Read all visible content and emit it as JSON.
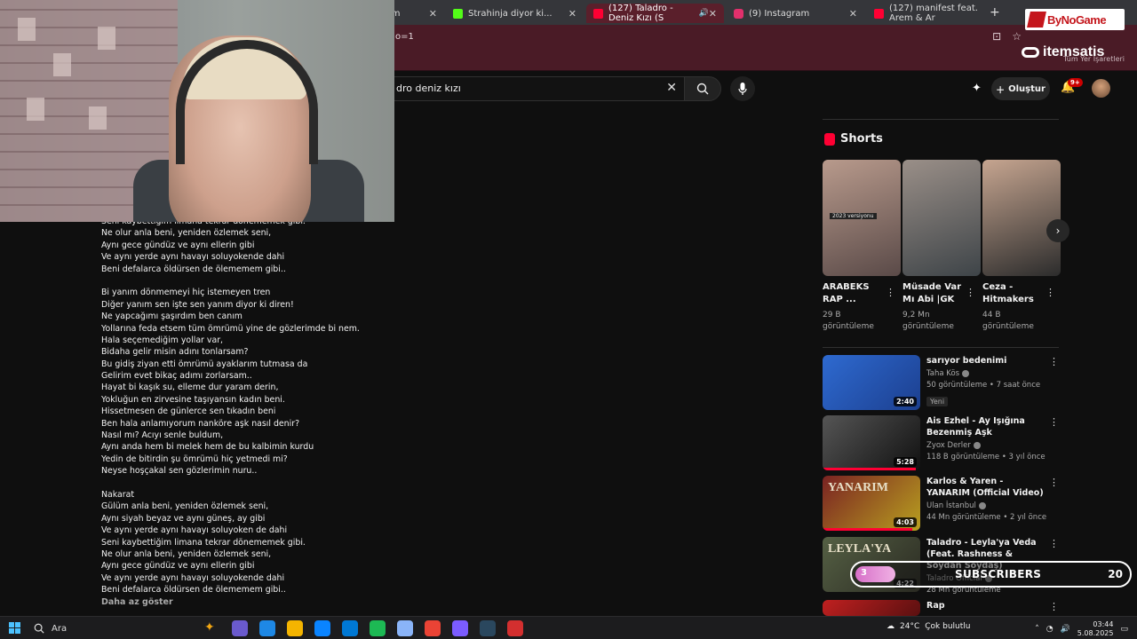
{
  "browser": {
    "tabs": [
      {
        "title": "im",
        "color": "#cc0000",
        "active": false
      },
      {
        "title": "Strahinja diyor ki...",
        "color": "#53fc18",
        "active": false
      },
      {
        "title": "(127) Taladro - Deniz Kızı (S",
        "color": "#ff0033",
        "active": true
      },
      {
        "title": "(9) Instagram",
        "color": "#e1306c",
        "active": false
      },
      {
        "title": "(127) manifest feat. Arem & Ar",
        "color": "#ff0033",
        "active": false
      }
    ],
    "address": "o=1",
    "bookmarks_text": "Tüm Yer İşaretleri",
    "close_glyph": "✕",
    "new_tab_glyph": "+"
  },
  "youtube": {
    "search_query": "dro deniz kızı",
    "create_label": "Oluştur",
    "notification_count": "9+"
  },
  "lyrics": [
    "Seni kaybettiğim limana tekrar dönememek gibi.",
    "Ne olur anla beni, yeniden özlemek seni,",
    "Aynı gece gündüz ve aynı ellerin gibi",
    "Ve aynı yerde aynı havayı soluyokende dahi",
    "Beni defalarca öldürsen de ölememem gibi..",
    "",
    "Bi yanım dönmemeyi hiç istemeyen tren",
    "Diğer yanım sen işte sen yanım diyor ki diren!",
    "Ne yapcağımı şaşırdım ben canım",
    "Yollarına feda etsem tüm ömrümü yine de gözlerimde bi nem.",
    "Hala seçemediğim yollar var,",
    "Bidaha gelir misin adını tonlarsam?",
    "Bu gidiş ziyan etti ömrümü ayaklarım tutmasa da",
    "Gelirim evet bikaç adımı zorlarsam..",
    "Hayat bi kaşık su, elleme dur yaram derin,",
    "Yokluğun en zirvesine taşıyansın kadın beni.",
    "Hissetmesen de günlerce sen tıkadın beni",
    "Ben hala anlamıyorum nankörе aşk nasıl denir?",
    "Nasıl mı? Acıyı senle buldum,",
    "Aynı anda hem bi melek hem de bu kalbimin kurdu",
    "Yedin de bitirdin şu ömrümü hiç yetmedi mi?",
    "Neyse hoşçakal sen gözlerimin nuru..",
    "",
    "Nakarat",
    "Gülüm anla beni, yeniden özlemek seni,",
    "Aynı siyah beyaz ve aynı güneş, ay gibi",
    "Ve aynı yerde aynı havayı soluyoken de dahi",
    "Seni kaybettiğim limana tekrar dönememek gibi.",
    "Ne olur anla beni, yeniden özlemek seni,",
    "Aynı gece gündüz ve aynı ellerin gibi",
    "Ve aynı yerde aynı havayı soluyokende dahi",
    "Beni defalarca öldürsen de ölememem gibi.."
  ],
  "show_less": "Daha az göster",
  "shorts": {
    "heading": "Shorts",
    "items": [
      {
        "title": "ARABEKS RAP ...",
        "views": "29 B görüntüleme",
        "thumb_label": "2023 versiyonu",
        "colors": [
          "#5a4a48",
          "#b89a8c"
        ]
      },
      {
        "title": "Müsade Var Mı Abi |GK ...",
        "views": "9,2 Mn görüntüleme",
        "thumb_label": "",
        "colors": [
          "#3e4448",
          "#9a8f88"
        ]
      },
      {
        "title": "Ceza - Hitmakers ...",
        "views": "44 B görüntüleme",
        "thumb_label": "",
        "colors": [
          "#2c2c2c",
          "#c6a590"
        ]
      }
    ]
  },
  "videos": [
    {
      "title": "sarıyor bedenimi",
      "channel": "Taha Kös",
      "meta": "50 görüntüleme • 7 saat önce",
      "badge": "Yeni",
      "duration": "2:40",
      "progress": 0,
      "colors": [
        "#1c3f8f",
        "#2e6ad0"
      ]
    },
    {
      "title": "Ais Ezhel - Ay Işığına Bezenmiş Aşk",
      "channel": "Zyox Derler",
      "meta": "118 B görüntüleme • 3 yıl önce",
      "badge": "",
      "duration": "5:28",
      "progress": 0.95,
      "colors": [
        "#111",
        "#555"
      ]
    },
    {
      "title": "Karlos & Yaren - YANARIM (Official Video)",
      "channel": "Ulan İstanbul",
      "meta": "44 Mn görüntüleme • 2 yıl önce",
      "badge": "",
      "duration": "4:03",
      "progress": 0.92,
      "colors": [
        "#b8a020",
        "#7a2222"
      ],
      "thumb_label": "YANARIM"
    },
    {
      "title": "Taladro - Leyla'ya Veda (Feat. Rashness & Soydan Soydaş)",
      "channel": "Taladro Official",
      "meta": "28 Mn görüntüleme",
      "badge": "",
      "duration": "4:22",
      "progress": 0,
      "colors": [
        "#2a2a22",
        "#556044"
      ],
      "thumb_label": "LEYLA'YA"
    },
    {
      "title": "Rap",
      "channel": "",
      "meta": "",
      "badge": "",
      "duration": "",
      "progress": 0,
      "colors": [
        "#5a1010",
        "#c02020"
      ]
    }
  ],
  "overlays": {
    "bynogame": "ByNoGame",
    "itemsatis": "itemsatis",
    "subscribers_label": "SUBSCRIBERS",
    "subscribers_current": "3",
    "subscribers_goal": "20",
    "subscribers_progress": 0.15
  },
  "taskbar": {
    "search_placeholder": "Ara",
    "weather_temp": "24°C",
    "weather_desc": "Çok bulutlu",
    "time": "03:44",
    "date": "5.08.2025",
    "apps": [
      "#f3a712",
      "#6a5acd",
      "#1e88e5",
      "#f4b400",
      "#0a84ff",
      "#0078d4",
      "#1db954",
      "#8ab4f8",
      "#ea4335",
      "#7b5cff",
      "#2a475e",
      "#d32f2f"
    ]
  }
}
